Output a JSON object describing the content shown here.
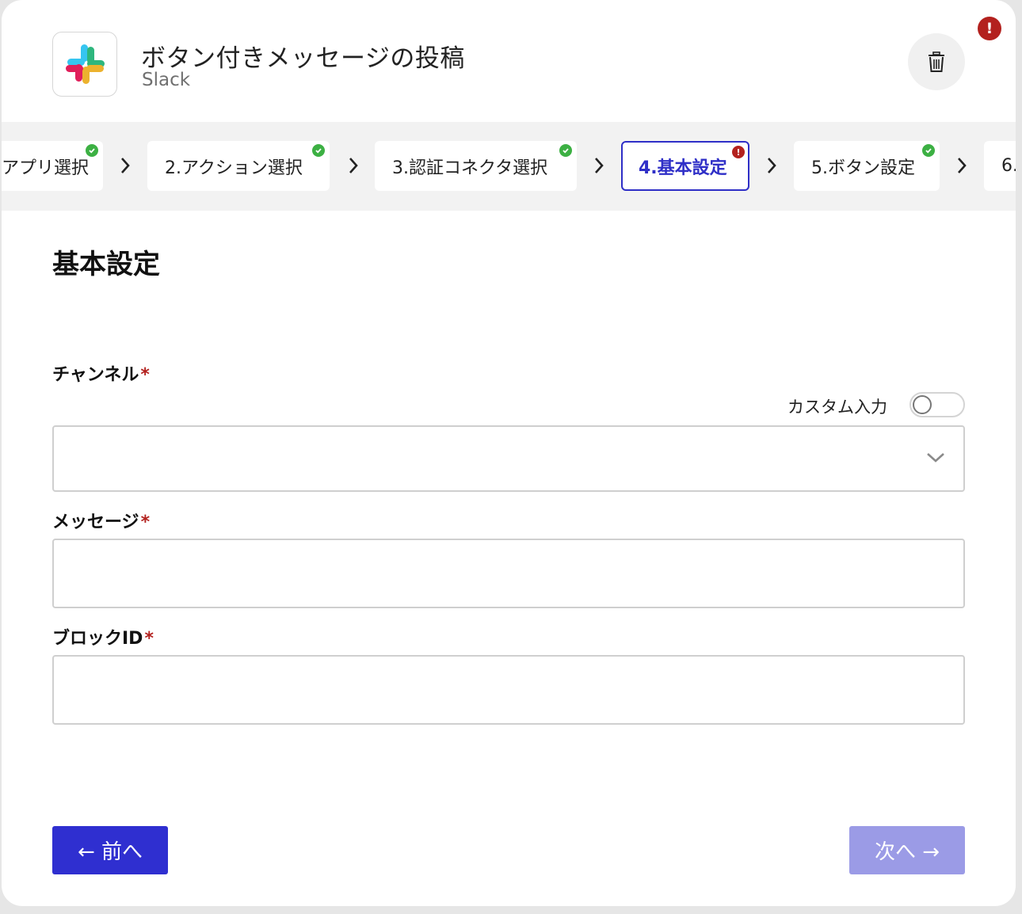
{
  "header": {
    "title": "ボタン付きメッセージの投稿",
    "subtitle": "Slack",
    "alert_symbol": "!"
  },
  "steps": [
    {
      "label": "アプリ選択",
      "status": "done"
    },
    {
      "label": "2.アクション選択",
      "status": "done"
    },
    {
      "label": "3.認証コネクタ選択",
      "status": "done"
    },
    {
      "label": "4.基本設定",
      "status": "error",
      "active": true
    },
    {
      "label": "5.ボタン設定",
      "status": "done"
    },
    {
      "label": "6.",
      "status": "none"
    }
  ],
  "form": {
    "section_title": "基本設定",
    "channel_label": "チャンネル",
    "custom_input_label": "カスタム入力",
    "message_label": "メッセージ",
    "block_id_label": "ブロックID",
    "required_mark": "*"
  },
  "buttons": {
    "prev": "← 前へ",
    "next": "次へ →"
  },
  "colors": {
    "accent": "#2f2fd0",
    "accent_disabled": "#9b9be6",
    "success": "#3cb043",
    "error": "#b3211e"
  }
}
